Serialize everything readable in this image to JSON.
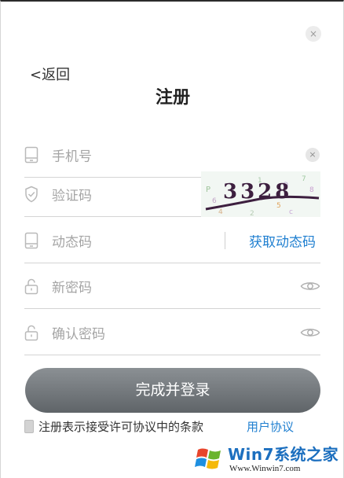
{
  "dialog": {
    "close_glyph": "×",
    "back_glyph": "<",
    "back_label": "返回",
    "title": "注册"
  },
  "fields": {
    "phone": {
      "placeholder": "手机号",
      "clear_glyph": "×"
    },
    "captcha": {
      "placeholder": "验证码",
      "image_text": "3328"
    },
    "dynamic_code": {
      "placeholder": "动态码",
      "action_label": "获取动态码"
    },
    "new_password": {
      "placeholder": "新密码"
    },
    "confirm_password": {
      "placeholder": "确认密码"
    }
  },
  "submit_label": "完成并登录",
  "terms": {
    "checked": false,
    "text": "注册表示接受许可协议中的条款",
    "link_label": "用户协议"
  },
  "watermark": {
    "brand": "Win7系统之家",
    "url": "Www.Winwin7.com"
  },
  "colors": {
    "accent": "#1f7fd0",
    "button_top": "#8b9094",
    "button_bottom": "#5f6468",
    "placeholder": "#a5a5a5",
    "divider": "#d4d4d4"
  }
}
